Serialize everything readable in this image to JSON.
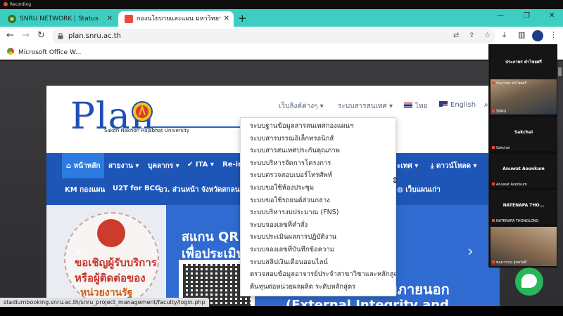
{
  "recording": {
    "label": "Recording"
  },
  "browser": {
    "tabs": [
      {
        "title": "SNRU NETWORK | Status",
        "close": "✕"
      },
      {
        "title": "กองนโยบายและแผน มหาวิทยาลัยราชภ",
        "close": "✕"
      }
    ],
    "new_tab": "+",
    "window_controls": {
      "minimize": "—",
      "maximize": "❐",
      "close": "✕"
    },
    "address": "plan.snru.ac.th",
    "bookmark": "Microsoft Office W..."
  },
  "site": {
    "logo_text": "Plan",
    "logo_subtitle": "Sakon Nakhon Rajabhat University",
    "topnav": {
      "links": "เว็บลิงค์ต่างๆ ▾",
      "systems": "ระบบสารสนเทศ ▾",
      "thai": "ไทย",
      "english": "English"
    },
    "nav": {
      "home": "หน้าหลัก",
      "line": "สายงาน ▾",
      "personnel": "บุคลากร ▾",
      "ita": "ITA ▾",
      "re_in": "Re-in",
      "info_tail": "ะเทศ ▾",
      "download": "ดาวน์โหลด ▾",
      "km": "KM กองแผน",
      "u2t": "U2T for BCG",
      "org": "อว. ส่วนหน้า จังหวัดสกลนคร",
      "old_web": "เว็บแผนเก่า"
    },
    "hero": {
      "left_line1": "ขอเชิญผู้รับบริการ",
      "left_line2": "หรือผู้ติดต่อของ",
      "left_line3": "หน่วยงานรัฐ",
      "qr_line1": "สแกน QR C",
      "qr_line2": "เพื่อประเมินเ",
      "right_line1": "เสียภายนอก",
      "right_line2": "(External Integrity and Transparency"
    },
    "dropdown": [
      "ระบบฐานข้อมูลสารสนเทศกองแผนฯ",
      "ระบบสารบรรณอิเล็กทรอนิกส์",
      "ระบบสารสนเทศประกันคุณภาพ",
      "ระบบบริหารจัดการโครงการ",
      "ระบบตรวจสอบเบอร์โทรศัพท์",
      "ระบบขอใช้ห้องประชุม",
      "ระบบขอใช้รถยนต์ส่วนกลาง",
      "ระบบบริหารงบประมาณ (FNS)",
      "ระบบจองเลขที่คำสั่ง",
      "ระบบประเมินผลการปฏิบัติงาน",
      "ระบบจองเลขที่บันทึกข้อความ",
      "ระบบสลิปเงินเดือนออนไลน์",
      "ตรวจสอบข้อมูลอาจารย์ประจำสาขาวิชาและหลักสูตร",
      "ต้นทุนต่อหน่วยผลผลิต ระดับหลักสูตร"
    ]
  },
  "status_url": "stadiumbooking.snru.ac.th/snru_project_management/faculty/login.php",
  "meeting": {
    "header": "ประภาพร คำไชยศรี",
    "tiles": [
      {
        "label": "ประภาพร คำไชยศรี",
        "name": ""
      },
      {
        "label": "SNRU",
        "name": ""
      },
      {
        "label": "Sakchai",
        "name": "Sakchai"
      },
      {
        "label": "Anuwat Aoonkum",
        "name": "Anuwat Aoonkum"
      },
      {
        "label": "NATENAPA THONGLONG",
        "name": "NATENAPA THO..."
      },
      {
        "label": "พนมวรรณ สุขสวัสดิ์",
        "name": ""
      }
    ]
  }
}
